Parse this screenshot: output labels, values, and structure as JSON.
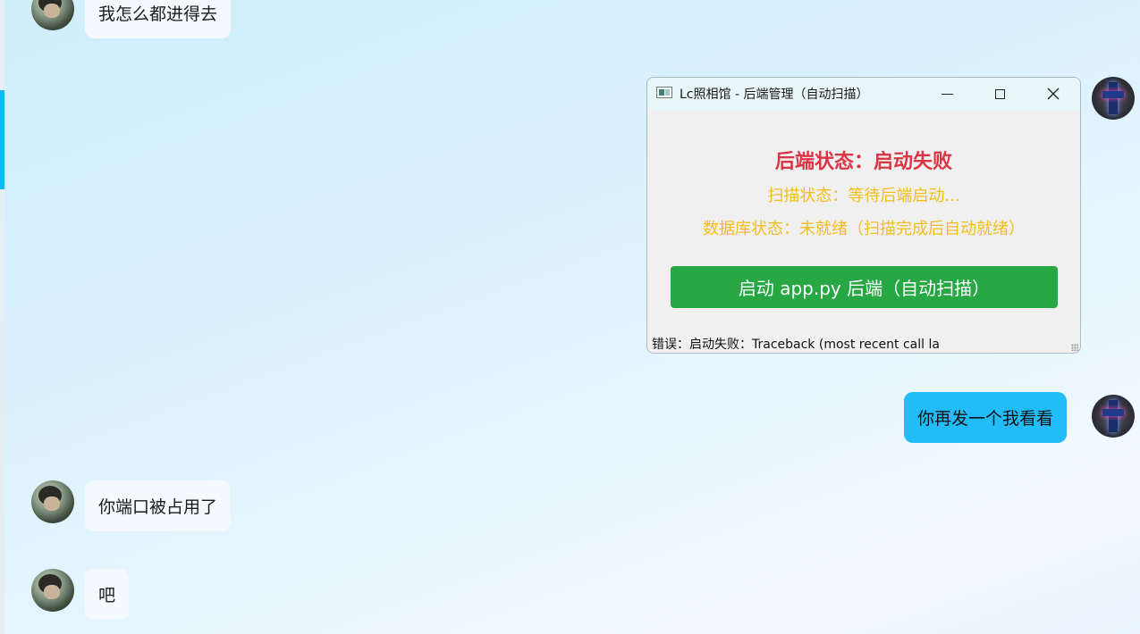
{
  "chat": {
    "messages": [
      {
        "sender": "other",
        "text": "我怎么都进得去"
      },
      {
        "sender": "self",
        "type": "screenshot"
      },
      {
        "sender": "self",
        "text": "你再发一个我看看"
      },
      {
        "sender": "other",
        "text": "你端口被占用了"
      },
      {
        "sender": "other",
        "text": "吧"
      }
    ]
  },
  "window": {
    "title": "Lc照相馆 - 后端管理（自动扫描）",
    "icons": {
      "minimize": "minimize-icon",
      "maximize": "maximize-icon",
      "close": "close-icon"
    },
    "backend_status": "后端状态：启动失败",
    "scan_status": "扫描状态：等待后端启动...",
    "db_status": "数据库状态：未就绪（扫描完成后自动就绪）",
    "start_button": "启动 app.py 后端（自动扫描）",
    "error_text": "错误：启动失败：Traceback (most recent call la"
  },
  "colors": {
    "accent": "#12b7f5",
    "self_bubble": "#22bdf9",
    "other_bubble": "#f4f9fe",
    "error_red": "#dc3545",
    "warning_yellow": "#f2bd1b",
    "start_green": "#28a745"
  }
}
